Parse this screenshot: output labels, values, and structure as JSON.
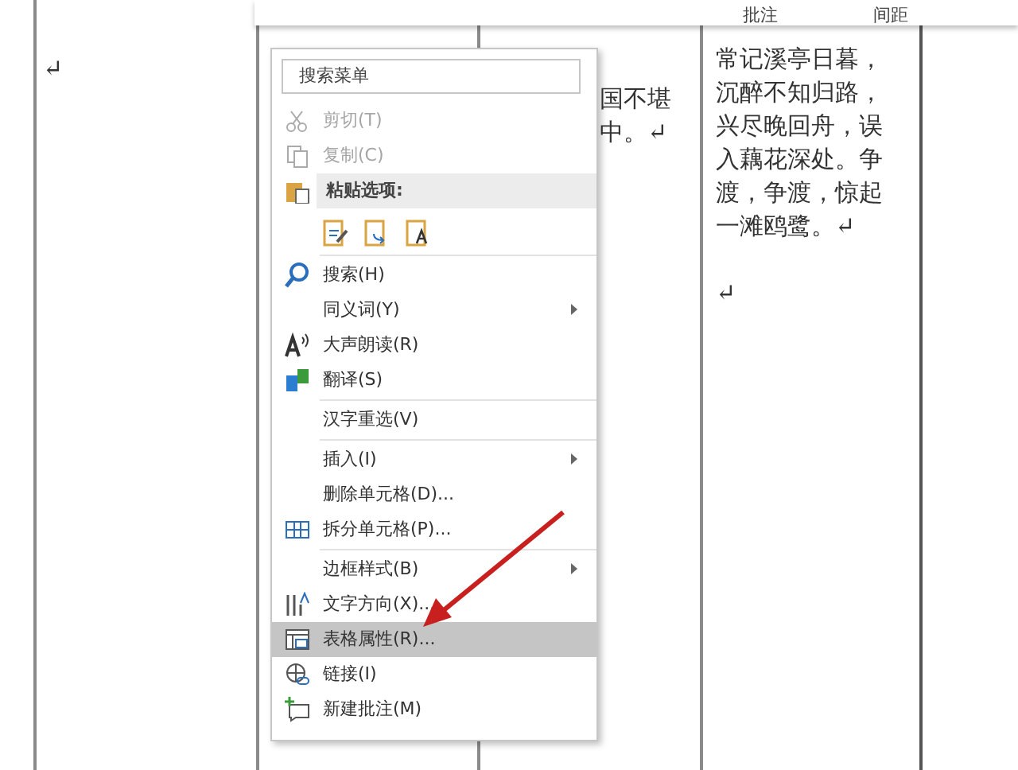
{
  "toolbar": {
    "buttons": [
      "批注",
      "间距"
    ]
  },
  "table": {
    "cells": [
      {
        "lines": [
          "↵"
        ]
      },
      {},
      {
        "lines": [
          "国不堪",
          "中。↵"
        ]
      },
      {
        "lines": [
          "常记溪亭日暮，",
          "沉醉不知归路，",
          "兴尽晚回舟，误",
          "入藕花深处。争",
          "渡，争渡，惊起",
          "一滩鸥鹭。↵"
        ],
        "after": [
          "↵"
        ]
      }
    ]
  },
  "context_menu": {
    "search": {
      "placeholder": "搜索菜单"
    },
    "items": [
      {
        "kind": "item",
        "label": "剪切(T)",
        "disabled": true,
        "selected": false,
        "submenu": false
      },
      {
        "kind": "item",
        "label": "复制(C)",
        "disabled": true,
        "selected": false,
        "submenu": false
      },
      {
        "kind": "header",
        "label": "粘贴选项:"
      },
      {
        "kind": "paste"
      },
      {
        "kind": "separator"
      },
      {
        "kind": "item",
        "label": "搜索(H)",
        "disabled": false,
        "selected": false,
        "submenu": false
      },
      {
        "kind": "item",
        "label": "同义词(Y)",
        "disabled": false,
        "selected": false,
        "submenu": true
      },
      {
        "kind": "item",
        "label": "大声朗读(R)",
        "disabled": false,
        "selected": false,
        "submenu": false
      },
      {
        "kind": "item",
        "label": "翻译(S)",
        "disabled": false,
        "selected": false,
        "submenu": false
      },
      {
        "kind": "separator"
      },
      {
        "kind": "item",
        "label": "汉字重选(V)",
        "disabled": false,
        "selected": false,
        "submenu": false
      },
      {
        "kind": "separator"
      },
      {
        "kind": "item",
        "label": "插入(I)",
        "disabled": false,
        "selected": false,
        "submenu": true
      },
      {
        "kind": "item",
        "label": "删除单元格(D)...",
        "disabled": false,
        "selected": false,
        "submenu": false
      },
      {
        "kind": "item",
        "label": "拆分单元格(P)...",
        "disabled": false,
        "selected": false,
        "submenu": false
      },
      {
        "kind": "separator"
      },
      {
        "kind": "item",
        "label": "边框样式(B)",
        "disabled": false,
        "selected": false,
        "submenu": true
      },
      {
        "kind": "item",
        "label": "文字方向(X)...",
        "disabled": false,
        "selected": false,
        "submenu": false
      },
      {
        "kind": "item",
        "label": "表格属性(R)...",
        "disabled": false,
        "selected": true,
        "submenu": false
      },
      {
        "kind": "item",
        "label": "链接(I)",
        "disabled": false,
        "selected": false,
        "submenu": false
      },
      {
        "kind": "item",
        "label": "新建批注(M)",
        "disabled": false,
        "selected": false,
        "submenu": false
      }
    ]
  }
}
